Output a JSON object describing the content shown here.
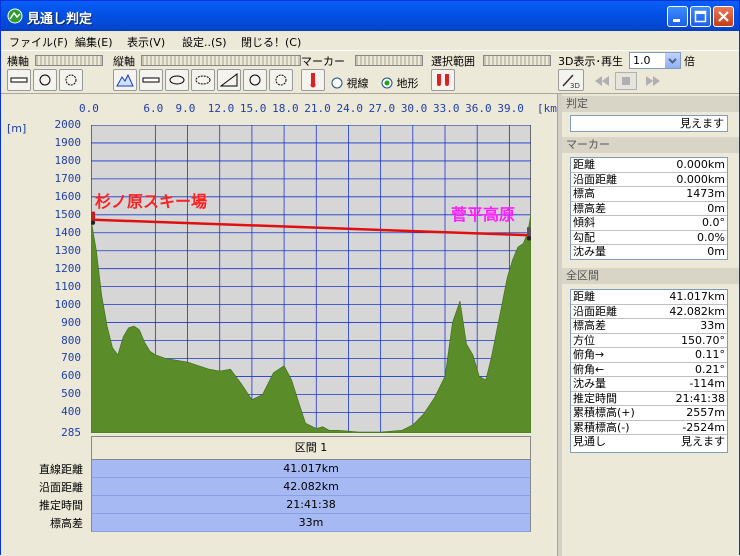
{
  "window": {
    "title": "見通し判定"
  },
  "menu": [
    "ファイル(F)",
    "編集(E)",
    "表示(V)",
    "設定..(S)",
    "閉じる！(C)"
  ],
  "toolbar": {
    "horizontal_label": "横軸",
    "vertical_label": "縦軸",
    "marker_label": "マーカー",
    "range_label": "選択範囲",
    "playback_label": "3D表示･再生",
    "speed_value": "1.0",
    "speed_unit": "倍",
    "radio_sight": "視線",
    "radio_terrain": "地形",
    "btn_3d_label": "3D"
  },
  "chart_data": {
    "type": "area",
    "xlabel": "[km]",
    "ylabel": "[m]",
    "x_ticks": [
      "0.0",
      "6.0",
      "9.0",
      "12.0",
      "15.0",
      "18.0",
      "21.0",
      "24.0",
      "27.0",
      "30.0",
      "33.0",
      "36.0",
      "39.0"
    ],
    "x_tick_values": [
      0,
      6,
      9,
      12,
      15,
      18,
      21,
      24,
      27,
      30,
      33,
      36,
      39
    ],
    "y_ticks": [
      "2000",
      "1900",
      "1800",
      "1700",
      "1600",
      "1500",
      "1400",
      "1300",
      "1200",
      "1100",
      "1000",
      "900",
      "800",
      "700",
      "600",
      "500",
      "400",
      "285"
    ],
    "y_tick_values": [
      2000,
      1900,
      1800,
      1700,
      1600,
      1500,
      1400,
      1300,
      1200,
      1100,
      1000,
      900,
      800,
      700,
      600,
      500,
      400,
      285
    ],
    "xlim": [
      0,
      41.017
    ],
    "ylim": [
      285,
      2000
    ],
    "profile": {
      "x": [
        0,
        0.5,
        1,
        1.5,
        2,
        2.5,
        3,
        3.5,
        4,
        4.5,
        5,
        5.5,
        6,
        7,
        8,
        9,
        10,
        11,
        12,
        13,
        14,
        15,
        16,
        17,
        18,
        18.7,
        19.5,
        20,
        21,
        21.6,
        22.2,
        23,
        24,
        25,
        26,
        27,
        28,
        29,
        30,
        31,
        32,
        33,
        33.7,
        34.4,
        35,
        35.6,
        36.2,
        36.8,
        37.3,
        37.8,
        38.3,
        38.8,
        39.3,
        39.8,
        40.3,
        40.7,
        41.017
      ],
      "y": [
        1473,
        1300,
        1050,
        880,
        760,
        720,
        820,
        870,
        880,
        860,
        790,
        740,
        720,
        700,
        690,
        680,
        660,
        640,
        630,
        640,
        560,
        470,
        500,
        620,
        660,
        580,
        430,
        340,
        310,
        320,
        300,
        300,
        295,
        290,
        290,
        290,
        295,
        300,
        330,
        390,
        480,
        600,
        900,
        1020,
        780,
        720,
        600,
        580,
        700,
        850,
        1000,
        1150,
        1250,
        1320,
        1340,
        1400,
        1506
      ]
    },
    "sight_line": {
      "x": [
        0,
        41.017
      ],
      "y": [
        1473,
        1386
      ]
    },
    "start_label": "杉ノ原スキー場",
    "end_label": "菅平高原",
    "colors": {
      "terrain": "#5a8c2a",
      "terrain_light": "#8fbf4a",
      "sight_line": "#e01010",
      "grid": "#1a37c8",
      "plot_bg": "#d6d6d6",
      "start_label": "#ff2020",
      "end_label": "#ff20ff"
    }
  },
  "section": {
    "header": "区間 1",
    "labels": [
      "直線距離",
      "沿面距離",
      "推定時間",
      "標高差"
    ],
    "values": [
      "41.017km",
      "42.082km",
      "21:41:38",
      "33m"
    ]
  },
  "sidebar": {
    "judgement_title": "判定",
    "judgement_value": "見えます",
    "marker_title": "マーカー",
    "marker_rows": [
      {
        "k": "距離",
        "v": "0.000km"
      },
      {
        "k": "沿面距離",
        "v": "0.000km"
      },
      {
        "k": "標高",
        "v": "1473m"
      },
      {
        "k": "標高差",
        "v": "0m"
      },
      {
        "k": "傾斜",
        "v": "0.0°"
      },
      {
        "k": "勾配",
        "v": "0.0%"
      },
      {
        "k": "沈み量",
        "v": "0m"
      }
    ],
    "all_title": "全区間",
    "all_rows": [
      {
        "k": "距離",
        "v": "41.017km"
      },
      {
        "k": "沿面距離",
        "v": "42.082km"
      },
      {
        "k": "標高差",
        "v": "33m"
      },
      {
        "k": "方位",
        "v": "150.70°"
      },
      {
        "k": "俯角→",
        "v": "0.11°"
      },
      {
        "k": "俯角←",
        "v": "0.21°"
      },
      {
        "k": "沈み量",
        "v": "-114m"
      },
      {
        "k": "推定時間",
        "v": "21:41:38"
      },
      {
        "k": "累積標高(+)",
        "v": "2557m"
      },
      {
        "k": "累積標高(-)",
        "v": "-2524m"
      },
      {
        "k": "見通し",
        "v": "見えます"
      }
    ]
  }
}
